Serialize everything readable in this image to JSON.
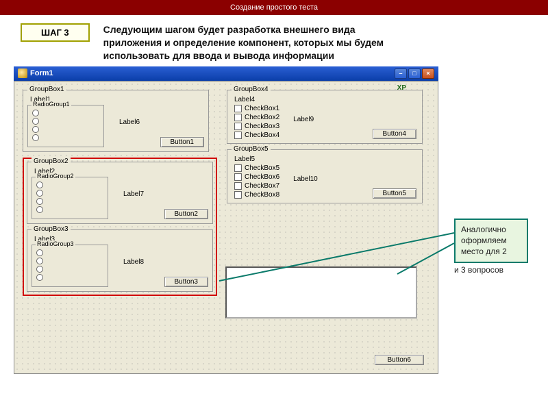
{
  "banner": "Создание простого теста",
  "step": "ШАГ 3",
  "intro": "Следующим шагом будет разработка внешнего вида приложения и определение компонент, которых мы будем использовать для ввода и вывода информации",
  "form_title": "Form1",
  "xp": "XP",
  "groups": [
    {
      "title": "GroupBox1",
      "label": "Label1",
      "radio": "RadioGroup1",
      "side": "Label6",
      "btn": "Button1"
    },
    {
      "title": "GroupBox2",
      "label": "Label2",
      "radio": "RadioGroup2",
      "side": "Label7",
      "btn": "Button2"
    },
    {
      "title": "GroupBox3",
      "label": "Label3",
      "radio": "RadioGroup3",
      "side": "Label8",
      "btn": "Button3"
    },
    {
      "title": "GroupBox4",
      "label": "Label4",
      "checks": [
        "CheckBox1",
        "CheckBox2",
        "CheckBox3",
        "CheckBox4"
      ],
      "side": "Label9",
      "btn": "Button4"
    },
    {
      "title": "GroupBox5",
      "label": "Label5",
      "checks": [
        "CheckBox5",
        "CheckBox6",
        "CheckBox7",
        "CheckBox8"
      ],
      "side": "Label10",
      "btn": "Button5"
    }
  ],
  "bottom_button": "Button6",
  "callout1": "Аналогично оформляем место для 2",
  "callout2": "и 3 вопросов"
}
